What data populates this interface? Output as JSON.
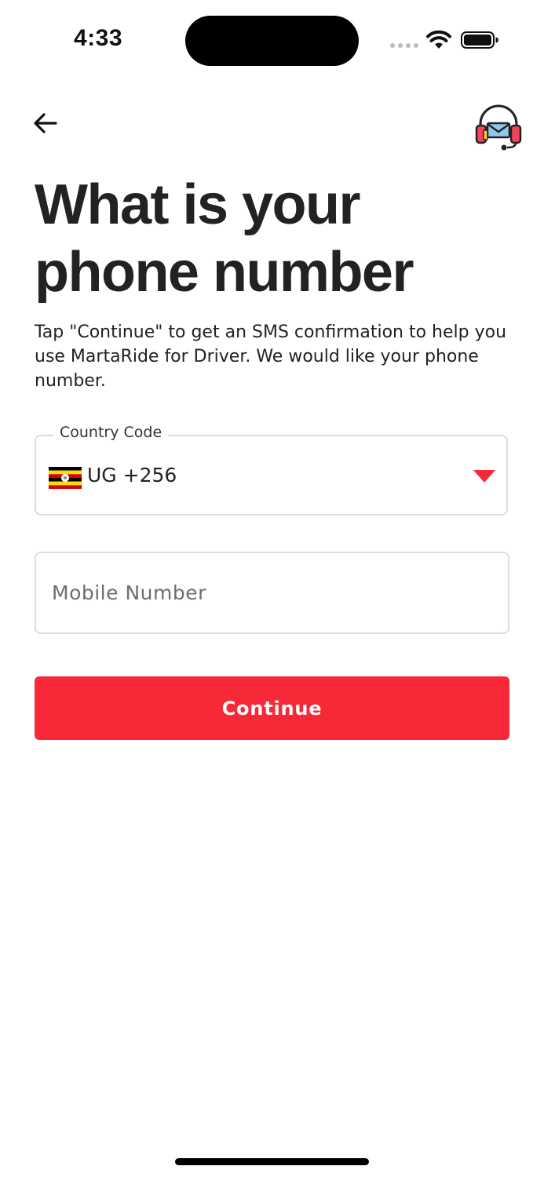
{
  "status_bar": {
    "time": "4:33"
  },
  "header": {
    "back_icon": "arrow-left-icon",
    "support_icon": "headset-support-icon"
  },
  "content": {
    "title": "What is your phone number",
    "description": "Tap \"Continue\" to get an SMS confirmation to help you use MartaRide for Driver. We would like your phone number."
  },
  "country_code": {
    "label": "Country Code",
    "value": "UG +256",
    "flag_icon": "uganda-flag-icon"
  },
  "mobile_number": {
    "value": "",
    "placeholder": "Mobile Number"
  },
  "continue_button": {
    "label": "Continue"
  },
  "colors": {
    "accent": "#f72838",
    "text": "#222222",
    "border": "#dddddd"
  }
}
